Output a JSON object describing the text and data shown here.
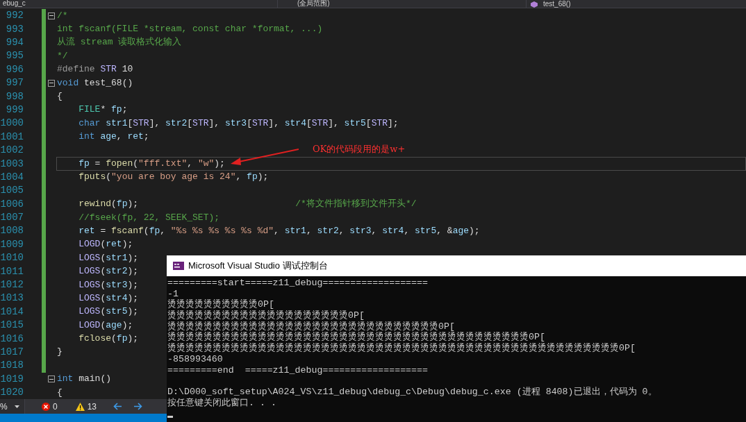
{
  "top_bar": {
    "project": "ebug_c",
    "scope": "(全局范围)",
    "function": "test_68()"
  },
  "editor": {
    "lines": [
      {
        "number": "992",
        "fold": true,
        "changed": true,
        "current": false,
        "tokens": [
          {
            "kind": "cm",
            "text": "/*"
          }
        ]
      },
      {
        "number": "993",
        "fold": false,
        "changed": true,
        "current": false,
        "tokens": [
          {
            "kind": "cm",
            "text": "int fscanf(FILE *stream, const char *format, ...)"
          }
        ]
      },
      {
        "number": "994",
        "fold": false,
        "changed": true,
        "current": false,
        "tokens": [
          {
            "kind": "cm",
            "text": "从流 stream 读取格式化输入"
          }
        ]
      },
      {
        "number": "995",
        "fold": false,
        "changed": true,
        "current": false,
        "tokens": [
          {
            "kind": "cm",
            "text": "*/"
          }
        ]
      },
      {
        "number": "996",
        "fold": false,
        "changed": true,
        "current": false,
        "tokens": [
          {
            "kind": "pp",
            "text": "#define "
          },
          {
            "kind": "mac",
            "text": "STR"
          },
          {
            "kind": "p",
            "text": " 10"
          }
        ]
      },
      {
        "number": "997",
        "fold": true,
        "changed": true,
        "current": false,
        "tokens": [
          {
            "kind": "kw",
            "text": "void"
          },
          {
            "kind": "p",
            "text": " test_68()"
          }
        ]
      },
      {
        "number": "998",
        "fold": false,
        "changed": true,
        "current": false,
        "tokens": [
          {
            "kind": "p",
            "text": "{"
          }
        ]
      },
      {
        "number": "999",
        "fold": false,
        "changed": true,
        "current": false,
        "tokens": [
          {
            "kind": "ty",
            "text": "    FILE"
          },
          {
            "kind": "p",
            "text": "* "
          },
          {
            "kind": "var",
            "text": "fp"
          },
          {
            "kind": "p",
            "text": ";"
          }
        ]
      },
      {
        "number": "1000",
        "fold": false,
        "changed": true,
        "current": false,
        "tokens": [
          {
            "kind": "kw",
            "text": "    char"
          },
          {
            "kind": "var",
            "text": " str1"
          },
          {
            "kind": "p",
            "text": "["
          },
          {
            "kind": "mac",
            "text": "STR"
          },
          {
            "kind": "p",
            "text": "], "
          },
          {
            "kind": "var",
            "text": "str2"
          },
          {
            "kind": "p",
            "text": "["
          },
          {
            "kind": "mac",
            "text": "STR"
          },
          {
            "kind": "p",
            "text": "], "
          },
          {
            "kind": "var",
            "text": "str3"
          },
          {
            "kind": "p",
            "text": "["
          },
          {
            "kind": "mac",
            "text": "STR"
          },
          {
            "kind": "p",
            "text": "], "
          },
          {
            "kind": "var",
            "text": "str4"
          },
          {
            "kind": "p",
            "text": "["
          },
          {
            "kind": "mac",
            "text": "STR"
          },
          {
            "kind": "p",
            "text": "], "
          },
          {
            "kind": "var",
            "text": "str5"
          },
          {
            "kind": "p",
            "text": "["
          },
          {
            "kind": "mac",
            "text": "STR"
          },
          {
            "kind": "p",
            "text": "];"
          }
        ]
      },
      {
        "number": "1001",
        "fold": false,
        "changed": true,
        "current": false,
        "tokens": [
          {
            "kind": "kw",
            "text": "    int"
          },
          {
            "kind": "var",
            "text": " age"
          },
          {
            "kind": "p",
            "text": ", "
          },
          {
            "kind": "var",
            "text": "ret"
          },
          {
            "kind": "p",
            "text": ";"
          }
        ]
      },
      {
        "number": "1002",
        "fold": false,
        "changed": true,
        "current": false
      },
      {
        "number": "1003",
        "fold": false,
        "changed": true,
        "current": true,
        "tokens": [
          {
            "kind": "var",
            "text": "    fp"
          },
          {
            "kind": "p",
            "text": " = "
          },
          {
            "kind": "fn",
            "text": "fopen"
          },
          {
            "kind": "p",
            "text": "("
          },
          {
            "kind": "str",
            "text": "\"fff.txt\""
          },
          {
            "kind": "p",
            "text": ", "
          },
          {
            "kind": "str",
            "text": "\"w\""
          },
          {
            "kind": "p",
            "text": ");"
          }
        ]
      },
      {
        "number": "1004",
        "fold": false,
        "changed": true,
        "current": false,
        "tokens": [
          {
            "kind": "fn",
            "text": "    fputs"
          },
          {
            "kind": "p",
            "text": "("
          },
          {
            "kind": "str",
            "text": "\"you are boy age is 24\""
          },
          {
            "kind": "p",
            "text": ", "
          },
          {
            "kind": "var",
            "text": "fp"
          },
          {
            "kind": "p",
            "text": ");"
          }
        ]
      },
      {
        "number": "1005",
        "fold": false,
        "changed": true,
        "current": false
      },
      {
        "number": "1006",
        "fold": false,
        "changed": true,
        "current": false,
        "tokens": [
          {
            "kind": "fn",
            "text": "    rewind"
          },
          {
            "kind": "p",
            "text": "("
          },
          {
            "kind": "var",
            "text": "fp"
          },
          {
            "kind": "p",
            "text": ");                             "
          },
          {
            "kind": "cm",
            "text": "/*将文件指针移到文件开头*/"
          }
        ]
      },
      {
        "number": "1007",
        "fold": false,
        "changed": true,
        "current": false,
        "tokens": [
          {
            "kind": "cm",
            "text": "    //fseek(fp, 22, SEEK_SET);"
          }
        ]
      },
      {
        "number": "1008",
        "fold": false,
        "changed": true,
        "current": false,
        "tokens": [
          {
            "kind": "var",
            "text": "    ret"
          },
          {
            "kind": "p",
            "text": " = "
          },
          {
            "kind": "fn",
            "text": "fscanf"
          },
          {
            "kind": "p",
            "text": "("
          },
          {
            "kind": "var",
            "text": "fp"
          },
          {
            "kind": "p",
            "text": ", "
          },
          {
            "kind": "str",
            "text": "\"%s %s %s %s %s %d\""
          },
          {
            "kind": "p",
            "text": ", "
          },
          {
            "kind": "var",
            "text": "str1"
          },
          {
            "kind": "p",
            "text": ", "
          },
          {
            "kind": "var",
            "text": "str2"
          },
          {
            "kind": "p",
            "text": ", "
          },
          {
            "kind": "var",
            "text": "str3"
          },
          {
            "kind": "p",
            "text": ", "
          },
          {
            "kind": "var",
            "text": "str4"
          },
          {
            "kind": "p",
            "text": ", "
          },
          {
            "kind": "var",
            "text": "str5"
          },
          {
            "kind": "p",
            "text": ", &"
          },
          {
            "kind": "var",
            "text": "age"
          },
          {
            "kind": "p",
            "text": ");"
          }
        ]
      },
      {
        "number": "1009",
        "fold": false,
        "changed": true,
        "current": false,
        "tokens": [
          {
            "kind": "mac",
            "text": "    LOGD"
          },
          {
            "kind": "p",
            "text": "("
          },
          {
            "kind": "var",
            "text": "ret"
          },
          {
            "kind": "p",
            "text": ");"
          }
        ]
      },
      {
        "number": "1010",
        "fold": false,
        "changed": true,
        "current": false,
        "tokens": [
          {
            "kind": "mac",
            "text": "    LOGS"
          },
          {
            "kind": "p",
            "text": "("
          },
          {
            "kind": "var",
            "text": "str1"
          },
          {
            "kind": "p",
            "text": ");"
          }
        ]
      },
      {
        "number": "1011",
        "fold": false,
        "changed": true,
        "current": false,
        "tokens": [
          {
            "kind": "mac",
            "text": "    LOGS"
          },
          {
            "kind": "p",
            "text": "("
          },
          {
            "kind": "var",
            "text": "str2"
          },
          {
            "kind": "p",
            "text": ");"
          }
        ]
      },
      {
        "number": "1012",
        "fold": false,
        "changed": true,
        "current": false,
        "tokens": [
          {
            "kind": "mac",
            "text": "    LOGS"
          },
          {
            "kind": "p",
            "text": "("
          },
          {
            "kind": "var",
            "text": "str3"
          },
          {
            "kind": "p",
            "text": ");"
          }
        ]
      },
      {
        "number": "1013",
        "fold": false,
        "changed": true,
        "current": false,
        "tokens": [
          {
            "kind": "mac",
            "text": "    LOGS"
          },
          {
            "kind": "p",
            "text": "("
          },
          {
            "kind": "var",
            "text": "str4"
          },
          {
            "kind": "p",
            "text": ");"
          }
        ]
      },
      {
        "number": "1014",
        "fold": false,
        "changed": true,
        "current": false,
        "tokens": [
          {
            "kind": "mac",
            "text": "    LOGS"
          },
          {
            "kind": "p",
            "text": "("
          },
          {
            "kind": "var",
            "text": "str5"
          },
          {
            "kind": "p",
            "text": ");"
          }
        ]
      },
      {
        "number": "1015",
        "fold": false,
        "changed": true,
        "current": false,
        "tokens": [
          {
            "kind": "mac",
            "text": "    LOGD"
          },
          {
            "kind": "p",
            "text": "("
          },
          {
            "kind": "var",
            "text": "age"
          },
          {
            "kind": "p",
            "text": ");"
          }
        ]
      },
      {
        "number": "1016",
        "fold": false,
        "changed": true,
        "current": false,
        "tokens": [
          {
            "kind": "fn",
            "text": "    fclose"
          },
          {
            "kind": "p",
            "text": "("
          },
          {
            "kind": "var",
            "text": "fp"
          },
          {
            "kind": "p",
            "text": ");"
          }
        ]
      },
      {
        "number": "1017",
        "fold": false,
        "changed": true,
        "current": false,
        "tokens": [
          {
            "kind": "p",
            "text": "}"
          }
        ]
      },
      {
        "number": "1018",
        "fold": false,
        "changed": true,
        "current": false
      },
      {
        "number": "1019",
        "fold": true,
        "changed": false,
        "current": false,
        "tokens": [
          {
            "kind": "kw",
            "text": "int"
          },
          {
            "kind": "p",
            "text": " main()"
          }
        ]
      },
      {
        "number": "1020",
        "fold": false,
        "changed": false,
        "current": false,
        "tokens": [
          {
            "kind": "p",
            "text": "{"
          }
        ]
      }
    ]
  },
  "annotation": {
    "text": "OK的代码段用的是w+"
  },
  "status_bar": {
    "zoom": "%",
    "errors": "0",
    "warnings": "13"
  },
  "console": {
    "title": "Microsoft Visual Studio 调试控制台",
    "lines": [
      {
        "text": "=========start=====z11_debug==================="
      },
      {
        "text": "-1"
      },
      {
        "text": "烫烫烫烫烫烫烫烫烫烫0P["
      },
      {
        "text": "烫烫烫烫烫烫烫烫烫烫烫烫烫烫烫烫烫烫烫烫0P["
      },
      {
        "text": "烫烫烫烫烫烫烫烫烫烫烫烫烫烫烫烫烫烫烫烫烫烫烫烫烫烫烫烫烫烫0P["
      },
      {
        "text": "烫烫烫烫烫烫烫烫烫烫烫烫烫烫烫烫烫烫烫烫烫烫烫烫烫烫烫烫烫烫烫烫烫烫烫烫烫烫烫烫0P["
      },
      {
        "text": "烫烫烫烫烫烫烫烫烫烫烫烫烫烫烫烫烫烫烫烫烫烫烫烫烫烫烫烫烫烫烫烫烫烫烫烫烫烫烫烫烫烫烫烫烫烫烫烫烫烫0P["
      },
      {
        "text": "-858993460"
      },
      {
        "text": "=========end  =====z11_debug==================="
      }
    ],
    "exit_lines": [
      {
        "text": "D:\\D000_soft_setup\\A024_VS\\z11_debug\\debug_c\\Debug\\debug_c.exe (进程 8408)已退出，代码为 0。"
      },
      {
        "text": "按任意键关闭此窗口. . ."
      }
    ]
  }
}
